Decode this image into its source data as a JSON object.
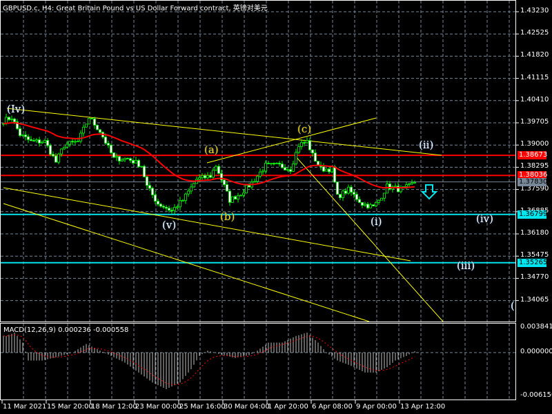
{
  "header": {
    "title": "GBPUSD.c, H4:  Great Britain Pound vs US Dollar Forward contract, 英镑对美元"
  },
  "price_axis": [
    "1.43230",
    "1.42525",
    "1.41820",
    "1.41115",
    "1.40410",
    "1.39705",
    "1.39000",
    "1.38295",
    "1.37590",
    "1.36885",
    "1.36180",
    "1.35475",
    "1.34770",
    "1.34065"
  ],
  "price_tags": [
    {
      "value": "1.38673",
      "color": "#ff0000"
    },
    {
      "value": "1.38036",
      "color": "#ff0000"
    },
    {
      "value": "1.37830",
      "color": "#778899"
    },
    {
      "value": "1.36799",
      "color": "#00e5ee"
    },
    {
      "value": "1.35265",
      "color": "#00e5ee"
    }
  ],
  "time_axis": [
    "11 Mar 2021",
    "15 Mar 20:00",
    "18 Mar 12:00",
    "23 Mar 00:00",
    "25 Mar 16:00",
    "30 Mar 04:00",
    "1 Apr 20:00",
    "6 Apr 08:00",
    "9 Apr 00:00",
    "13 Apr 12:00"
  ],
  "macd": {
    "label": "MACD(12,26,9) 0.000236 -0.000558",
    "axis": [
      "0.003841",
      "0.000000",
      "-0.006150"
    ]
  },
  "wave_labels": [
    {
      "text": "(Iv)",
      "color": "#ffffff"
    },
    {
      "text": "(a)",
      "color": "#ffd700"
    },
    {
      "text": "(b)",
      "color": "#ffd700"
    },
    {
      "text": "(c)",
      "color": "#ffd700"
    },
    {
      "text": "(ii)",
      "color": "#ffffff"
    },
    {
      "text": "(i)",
      "color": "#ffffff"
    },
    {
      "text": "(v)",
      "color": "#ffffff"
    },
    {
      "text": "(iv)",
      "color": "#ffffff"
    },
    {
      "text": "(iii)",
      "color": "#ffffff"
    },
    {
      "text": "(",
      "color": "#ffffff"
    }
  ],
  "chart_data": {
    "type": "candlestick",
    "symbol": "GBPUSD.c",
    "timeframe": "H4",
    "ylim": [
      1.3365,
      1.4345
    ],
    "close_anchors": [
      [
        0,
        1.3977
      ],
      [
        3,
        1.3988
      ],
      [
        6,
        1.3933
      ],
      [
        10,
        1.3911
      ],
      [
        15,
        1.3911
      ],
      [
        19,
        1.3846
      ],
      [
        22,
        1.39
      ],
      [
        27,
        1.3911
      ],
      [
        31,
        1.3988
      ],
      [
        35,
        1.3944
      ],
      [
        40,
        1.3857
      ],
      [
        45,
        1.3857
      ],
      [
        50,
        1.3835
      ],
      [
        52,
        1.3769
      ],
      [
        56,
        1.3714
      ],
      [
        61,
        1.3692
      ],
      [
        65,
        1.3725
      ],
      [
        70,
        1.3791
      ],
      [
        75,
        1.3802
      ],
      [
        77,
        1.3835
      ],
      [
        80,
        1.3769
      ],
      [
        82,
        1.3725
      ],
      [
        86,
        1.3747
      ],
      [
        90,
        1.378
      ],
      [
        95,
        1.3835
      ],
      [
        100,
        1.3835
      ],
      [
        104,
        1.3824
      ],
      [
        107,
        1.39
      ],
      [
        110,
        1.3911
      ],
      [
        112,
        1.3868
      ],
      [
        115,
        1.3824
      ],
      [
        119,
        1.3824
      ],
      [
        121,
        1.3736
      ],
      [
        125,
        1.3758
      ],
      [
        130,
        1.3714
      ],
      [
        134,
        1.3703
      ],
      [
        136,
        1.3725
      ],
      [
        139,
        1.3769
      ],
      [
        144,
        1.3758
      ],
      [
        147,
        1.3769
      ],
      [
        149,
        1.3783
      ]
    ],
    "macd_anchors": [
      [
        1,
        0.0025
      ],
      [
        4,
        0.003
      ],
      [
        7,
        0.0015
      ],
      [
        9,
        -0.0012
      ],
      [
        14,
        -0.0012
      ],
      [
        19,
        -0.0007
      ],
      [
        25,
        0
      ],
      [
        27,
        0.0005
      ],
      [
        30,
        0.0013
      ],
      [
        34,
        0.0005
      ],
      [
        39,
        -0.0005
      ],
      [
        44,
        -0.0015
      ],
      [
        49,
        -0.003
      ],
      [
        54,
        -0.0045
      ],
      [
        59,
        -0.0055
      ],
      [
        64,
        -0.0045
      ],
      [
        68,
        -0.0025
      ],
      [
        71,
        -0.0005
      ],
      [
        74,
        0.0003
      ],
      [
        79,
        -0.0003
      ],
      [
        84,
        -0.0008
      ],
      [
        89,
        -0.0004
      ],
      [
        92,
        0.0003
      ],
      [
        96,
        0.0015
      ],
      [
        101,
        0.0015
      ],
      [
        106,
        0.0025
      ],
      [
        110,
        0.003
      ],
      [
        114,
        0.0015
      ],
      [
        117,
        0
      ],
      [
        121,
        -0.0012
      ],
      [
        126,
        -0.002
      ],
      [
        131,
        -0.003
      ],
      [
        135,
        -0.003
      ],
      [
        139,
        -0.0022
      ],
      [
        142,
        -0.0012
      ],
      [
        146,
        -0.0005
      ],
      [
        149,
        0.0002
      ]
    ],
    "horizontal_levels": [
      1.38673,
      1.38036,
      1.3783,
      1.36799,
      1.35265
    ]
  }
}
